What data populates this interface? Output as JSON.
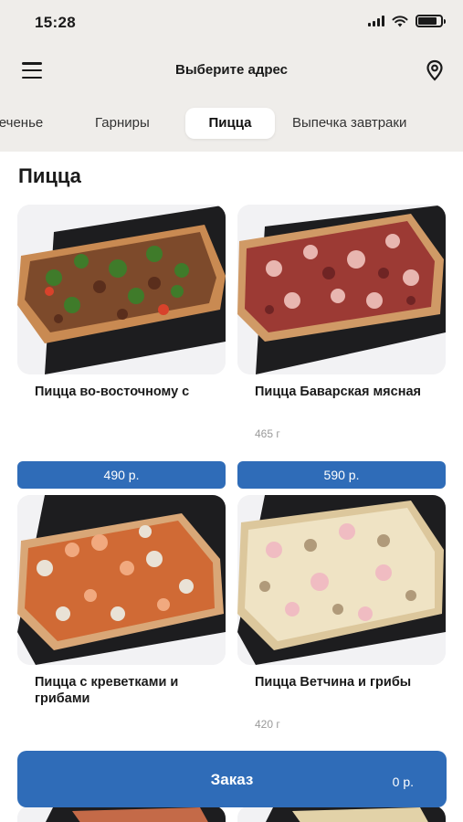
{
  "status": {
    "time": "15:28"
  },
  "header": {
    "title": "Выберите адрес",
    "menu_icon": "menu-icon",
    "location_icon": "location-pin-icon"
  },
  "tabs": [
    {
      "label": "Печенье",
      "active": false
    },
    {
      "label": "Гарниры",
      "active": false
    },
    {
      "label": "Пицца",
      "active": true
    },
    {
      "label": "Выпечка завтраки",
      "active": false
    }
  ],
  "section": {
    "title": "Пицца"
  },
  "products": [
    {
      "name": "Пицца во-восточному с",
      "weight": "",
      "price": "490 р."
    },
    {
      "name": "Пицца Баварская мясная",
      "weight": "465 г",
      "price": "590 р."
    },
    {
      "name": "Пицца с креветками и грибами",
      "weight": "",
      "price": ""
    },
    {
      "name": "Пицца Ветчина и грибы",
      "weight": "420 г",
      "price": ""
    }
  ],
  "order": {
    "label": "Заказ",
    "total": "0 р."
  },
  "colors": {
    "accent": "#2f6cb8",
    "background": "#efedea"
  }
}
